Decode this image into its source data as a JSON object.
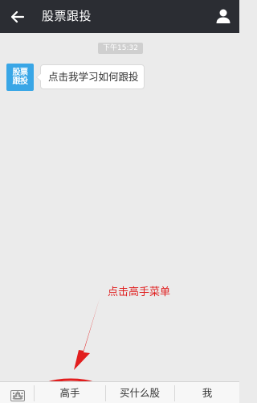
{
  "header": {
    "back_icon": "back-arrow-icon",
    "title": "股票跟投",
    "profile_icon": "person-icon"
  },
  "chat": {
    "time": "下午15:32",
    "avatar": {
      "line1": "股票",
      "line2": "跟投"
    },
    "message": "点击我学习如何跟投"
  },
  "annotation": {
    "text": "点击高手菜单",
    "color": "#e02020"
  },
  "bottom_menu": {
    "keyboard_icon": "keyboard-icon",
    "items": [
      {
        "label": "高手"
      },
      {
        "label": "买什么股"
      },
      {
        "label": "我"
      }
    ]
  },
  "colors": {
    "topbar": "#2b2d33",
    "background": "#ebebeb",
    "avatar": "#39a6e6"
  }
}
